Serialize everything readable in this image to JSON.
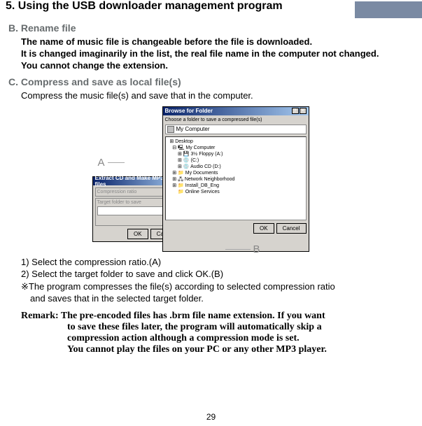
{
  "header": {
    "title": "5. Using the USB downloader management program"
  },
  "sectionB": {
    "heading": "B. Rename file",
    "line1": "The name of music file is changeable before the file is downloaded.",
    "line2": "It is changed imaginarily in the list, the real file name in the computer not changed.",
    "line3": "You cannot change the extension."
  },
  "sectionC": {
    "heading": "C. Compress and save as local file(s)",
    "intro": "Compress the music file(s) and save that in the computer."
  },
  "labels": {
    "A": "A",
    "B": "B"
  },
  "dialogA": {
    "title": "Extract CD and Make MP3 files",
    "group1": "Compression ratio",
    "group2": "Target folder to save",
    "ok": "OK",
    "cancel": "Cancel"
  },
  "dialogB": {
    "title": "Browse for Folder",
    "instr": "Choose a folder to save a compressed file(s)",
    "combo": "My Computer",
    "tree": {
      "i1": "  ⊞ Desktop",
      "i2": "    ⊟ 🖳 My Computer",
      "i3": "        ⊞ 💾 3½ Floppy (A:)",
      "i4": "        ⊞ 💿 (C:)",
      "i5": "        ⊞ 💿 Audio CD (D:)",
      "i6": "    ⊞ 📁 My Documents",
      "i7": "    ⊞ 🖧 Network Neighborhood",
      "i8": "    ⊞ 📁 Install_DB_Eng",
      "i9": "        📁 Online Services"
    },
    "ok": "OK",
    "cancel": "Cancel"
  },
  "steps": {
    "s1": "1) Select the compression ratio.(A)",
    "s2": "2) Select the target folder to save and click OK.(B)",
    "noteSym": "※",
    "noteA": "The program compresses the file(s) according to selected compression ratio",
    "noteB": "and saves that in the selected target folder."
  },
  "remark": {
    "lead": "Remark: The pre-encoded files has .brm file name extension. If you want",
    "l2": "to save these files later, the program will automatically skip a",
    "l3": "compression action although a compression mode is set.",
    "l4": "You cannot play the files on your PC or any other MP3 player."
  },
  "pageNum": "29"
}
